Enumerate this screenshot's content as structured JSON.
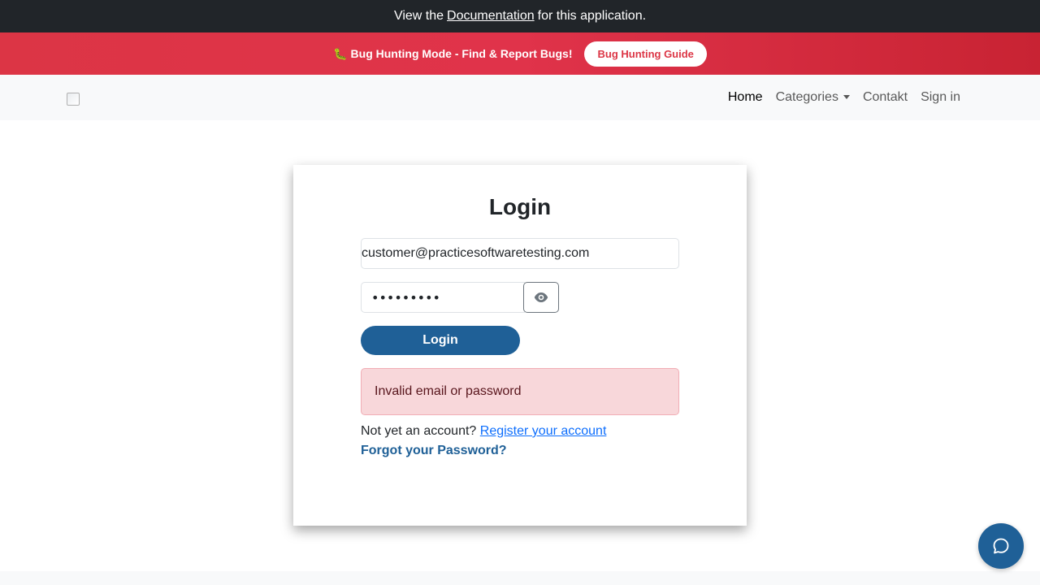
{
  "doc_bar": {
    "prefix": "View the",
    "link": "Documentation",
    "suffix": "for this application."
  },
  "bug_bar": {
    "icon": "🐛",
    "message": "Bug Hunting Mode - Find & Report Bugs!",
    "guide_button": "Bug Hunting Guide"
  },
  "nav": {
    "home": "Home",
    "categories": "Categories",
    "contact": "Contakt",
    "sign_in": "Sign in"
  },
  "login": {
    "title": "Login",
    "email_value": "customer@practicesoftwaretesting.com",
    "password_value": "welcome01",
    "button": "Login",
    "error": "Invalid email or password",
    "register_prefix": "Not yet an account?",
    "register_link": "Register your account",
    "forgot_link": "Forgot your Password?"
  },
  "colors": {
    "primary": "#1f6097",
    "danger": "#dc3545",
    "alert_bg": "#f8d7da",
    "dark": "#212529"
  },
  "icons": {
    "eye": "eye-icon",
    "chat": "chat-icon",
    "bug": "bug-icon"
  }
}
